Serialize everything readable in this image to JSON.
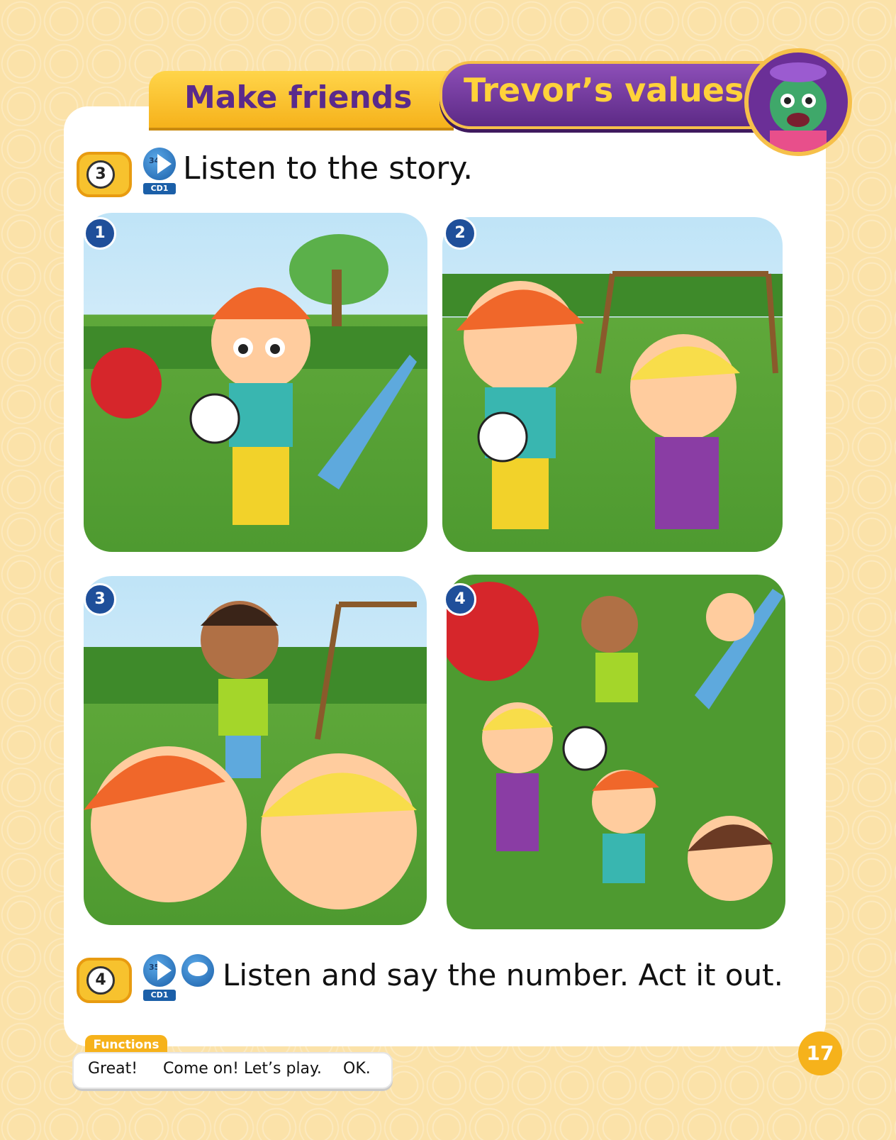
{
  "header": {
    "make_friends": "Make friends",
    "trevors_values": "Trevor’s values"
  },
  "activity3": {
    "number": "3",
    "track": "34",
    "cd": "CD1",
    "instruction": "Listen to the story."
  },
  "panels": [
    "1",
    "2",
    "3",
    "4"
  ],
  "activity4": {
    "number": "4",
    "track": "35",
    "cd": "CD1",
    "instruction": "Listen and say the number. Act it out."
  },
  "functions": {
    "label": "Functions",
    "phrases": [
      "Great!",
      "Come on! Let’s play.",
      "OK."
    ]
  },
  "page_number": "17",
  "colors": {
    "tab_yellow": "#f6b21b",
    "tab_purple": "#5d2a86",
    "badge_blue": "#1f4f9a",
    "grass_green": "#4e9a30"
  }
}
